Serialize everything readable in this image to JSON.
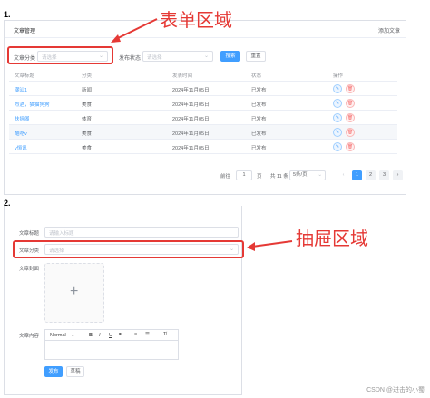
{
  "steps": {
    "one": "1.",
    "two": "2."
  },
  "annotations": {
    "form_area": "表单区域",
    "drawer_area": "抽屉区域"
  },
  "list_page": {
    "title": "文章管理",
    "add_button": "添加文章",
    "filters": {
      "category_label": "文章分类",
      "category_placeholder": "请选择",
      "status_label": "发布状态",
      "status_placeholder": "请选择",
      "search_button": "搜索",
      "reset_button": "重置"
    },
    "table": {
      "headers": [
        "文章标题",
        "分类",
        "发表时间",
        "状态",
        "操作"
      ],
      "rows": [
        {
          "title": "潮汕1",
          "category": "新闻",
          "date": "2024年11月05日",
          "status": "已发布"
        },
        {
          "title": "烈酒，猫猫狗狗",
          "category": "美食",
          "date": "2024年11月05日",
          "status": "已发布"
        },
        {
          "title": "扶摇阁",
          "category": "体育",
          "date": "2024年11月05日",
          "status": "已发布"
        },
        {
          "title": "酷吃v",
          "category": "美食",
          "date": "2024年11月05日",
          "status": "已发布"
        },
        {
          "title": "y恒讯",
          "category": "美食",
          "date": "2024年11月05日",
          "status": "已发布"
        }
      ]
    },
    "pagination": {
      "goto_label": "前往",
      "page_value": "1",
      "page_suffix": "页",
      "total_text": "共 11 条",
      "page_size": "5条/页",
      "pages": [
        "1",
        "2",
        "3"
      ],
      "prev": "‹",
      "next": "›"
    }
  },
  "drawer": {
    "title_label": "文章标题",
    "title_placeholder": "请输入标题",
    "category_label": "文章分类",
    "category_placeholder": "请选择",
    "cover_label": "文章封面",
    "content_label": "文章内容",
    "toolbar": {
      "format": "Normal",
      "bold": "B",
      "italic": "I",
      "underline": "U"
    },
    "publish_button": "发布",
    "draft_button": "草稿"
  },
  "watermark": "CSDN @进击的小蜀",
  "colors": {
    "primary": "#409eff",
    "annotation_red": "#e53935",
    "danger": "#f56c6c"
  }
}
